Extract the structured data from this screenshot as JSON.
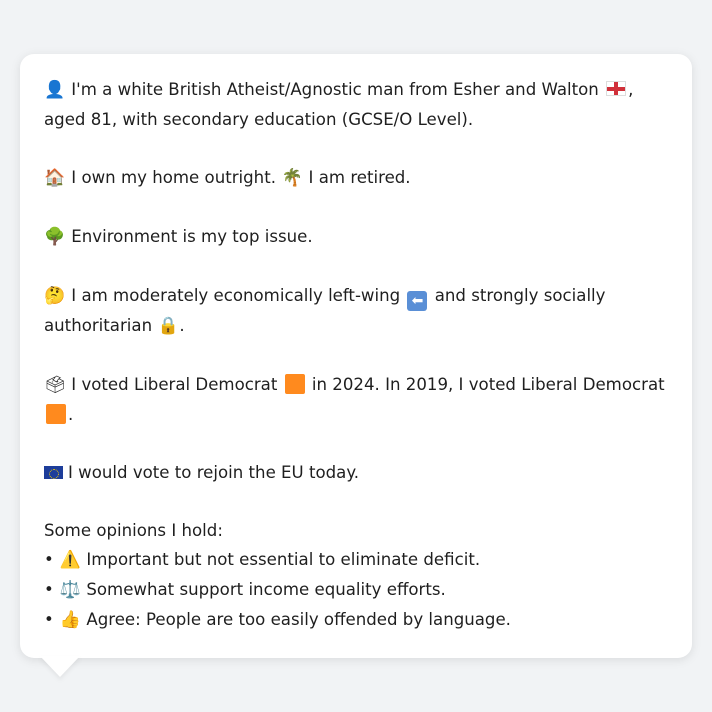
{
  "profile": {
    "line1": {
      "icon": "person-icon",
      "text_a": "I'm a white British Atheist/Agnostic man from Esher and Walton",
      "flag": "england-flag-icon",
      "text_b": ", aged 81, with secondary education (GCSE/O Level)."
    },
    "line2": {
      "icon1": "house-icon",
      "text_a": "I own my home outright.",
      "icon2": "palm-tree-icon",
      "text_b": "I am retired."
    },
    "line3": {
      "icon": "tree-icon",
      "text": "Environment is my top issue."
    },
    "line4": {
      "icon1": "thinking-face-icon",
      "text_a": "I am moderately economically left-wing",
      "icon2": "left-arrow-icon",
      "text_b": "and strongly socially authoritarian",
      "icon3": "lock-icon",
      "text_c": "."
    },
    "line5": {
      "icon": "ballot-box-icon",
      "text_a": "I voted Liberal Democrat",
      "text_b": "in 2024. In 2019, I voted Liberal Democrat",
      "text_c": ".",
      "party_color": "#ff8a1e"
    },
    "line6": {
      "icon": "eu-flag-icon",
      "text": "I would vote to rejoin the EU today."
    },
    "opinions_heading": "Some opinions I hold:",
    "opinions": [
      {
        "bullet": "•",
        "icon": "warning-icon",
        "text": "Important but not essential to eliminate deficit."
      },
      {
        "bullet": "•",
        "icon": "scales-icon",
        "text": "Somewhat support income equality efforts."
      },
      {
        "bullet": "•",
        "icon": "thumbs-up-icon",
        "text": "Agree: People are too easily offended by language."
      }
    ]
  }
}
